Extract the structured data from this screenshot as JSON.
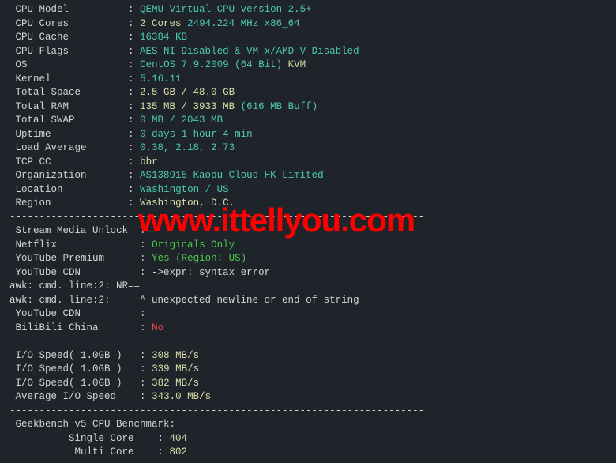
{
  "system": {
    "cpu_model": {
      "label": "CPU Model",
      "value": "QEMU Virtual CPU version 2.5+"
    },
    "cpu_cores": {
      "label": "CPU Cores",
      "value": "2 Cores",
      "extra": "2494.224 MHz x86_64"
    },
    "cpu_cache": {
      "label": "CPU Cache",
      "value": "16384 KB"
    },
    "cpu_flags": {
      "label": "CPU Flags",
      "value": "AES-NI Disabled & VM-x/AMD-V Disabled"
    },
    "os": {
      "label": "OS",
      "value": "CentOS 7.9.2009 (64 Bit)",
      "extra": "KVM"
    },
    "kernel": {
      "label": "Kernel",
      "value": "5.16.11"
    },
    "total_space": {
      "label": "Total Space",
      "value": "2.5 GB / 48.0 GB"
    },
    "total_ram": {
      "label": "Total RAM",
      "value": "135 MB / 3933 MB",
      "extra": "(616 MB Buff)"
    },
    "total_swap": {
      "label": "Total SWAP",
      "value": "0 MB / 2043 MB"
    },
    "uptime": {
      "label": "Uptime",
      "value": "0 days 1 hour 4 min"
    },
    "load_avg": {
      "label": "Load Average",
      "value": "0.38, 2.18, 2.73"
    },
    "tcp_cc": {
      "label": "TCP CC",
      "value": "bbr"
    },
    "organization": {
      "label": "Organization",
      "value": "AS138915 Kaopu Cloud HK Limited"
    },
    "location": {
      "label": "Location",
      "value": "Washington / US"
    },
    "region": {
      "label": "Region",
      "value": "Washington, D.C."
    }
  },
  "stream": {
    "header": "Stream Media Unlock",
    "netflix": {
      "label": "Netflix",
      "value": "Originals Only"
    },
    "youtube_premium": {
      "label": "YouTube Premium",
      "value": "Yes (Region: US)"
    },
    "youtube_cdn": {
      "label": "YouTube CDN",
      "value": "->expr: syntax error"
    },
    "awk1": "awk: cmd. line:2: NR==",
    "awk2": {
      "prefix": "awk: cmd. line:2:     ",
      "msg": "^ unexpected newline or end of string"
    },
    "youtube_cdn2": {
      "label": "YouTube CDN",
      "value": ""
    },
    "bilibili": {
      "label": "BiliBili China",
      "value": "No"
    }
  },
  "io": {
    "test1": {
      "label": "I/O Speed( 1.0GB )",
      "value": "308 MB/s"
    },
    "test2": {
      "label": "I/O Speed( 1.0GB )",
      "value": "339 MB/s"
    },
    "test3": {
      "label": "I/O Speed( 1.0GB )",
      "value": "382 MB/s"
    },
    "avg": {
      "label": "Average I/O Speed",
      "value": "343.0 MB/s"
    }
  },
  "geekbench": {
    "header": "Geekbench v5 CPU Benchmark:",
    "single": {
      "label": "Single Core",
      "value": "404"
    },
    "multi": {
      "label": "Multi Core",
      "value": "802"
    }
  },
  "dashes": "----------------------------------------------------------------------",
  "watermark": "www.ittellyou.com"
}
